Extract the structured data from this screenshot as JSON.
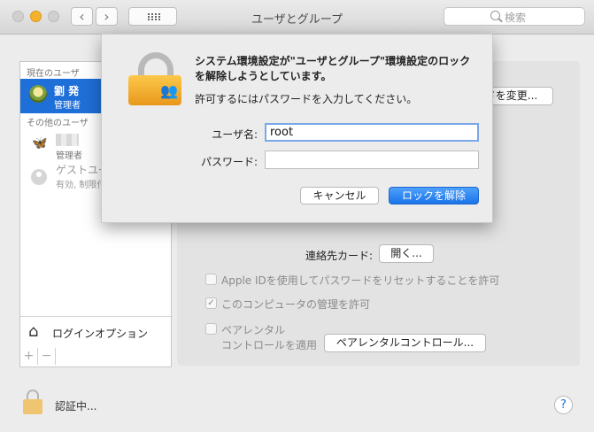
{
  "window": {
    "title": "ユーザとグループ",
    "search_placeholder": "検索"
  },
  "toolbar": {
    "back": "‹",
    "forward": "›"
  },
  "sidebar": {
    "current_users_header": "現在のユーザ",
    "current_user": {
      "name": "劉 発",
      "role": "管理者"
    },
    "other_users_header": "その他のユーザ",
    "other_user": {
      "role": "管理者"
    },
    "guest_user": {
      "name": "ゲストユーザ",
      "sub": "有効, 制限付き"
    },
    "login_options": "ログインオプション",
    "add": "+",
    "remove": "−"
  },
  "main": {
    "change_password_button": "ドを変更...",
    "contact_card_label": "連絡先カード:",
    "open_button": "開く...",
    "apple_id_reset": "Apple IDを使用してパスワードをリセットすることを許可",
    "allow_admin": "このコンピュータの管理を許可",
    "parental_line1": "ペアレンタル",
    "parental_line2": "コントロールを適用",
    "parental_button": "ペアレンタルコントロール..."
  },
  "sheet": {
    "message": "システム環境設定が\"ユーザとグループ\"環境設定のロックを解除しようとしています。",
    "prompt": "許可するにはパスワードを入力してください。",
    "username_label": "ユーザ名:",
    "username_value": "root",
    "password_label": "パスワード:",
    "password_value": "",
    "cancel_button": "キャンセル",
    "unlock_button": "ロックを解除"
  },
  "footer": {
    "auth_status": "認証中...",
    "help": "?"
  }
}
